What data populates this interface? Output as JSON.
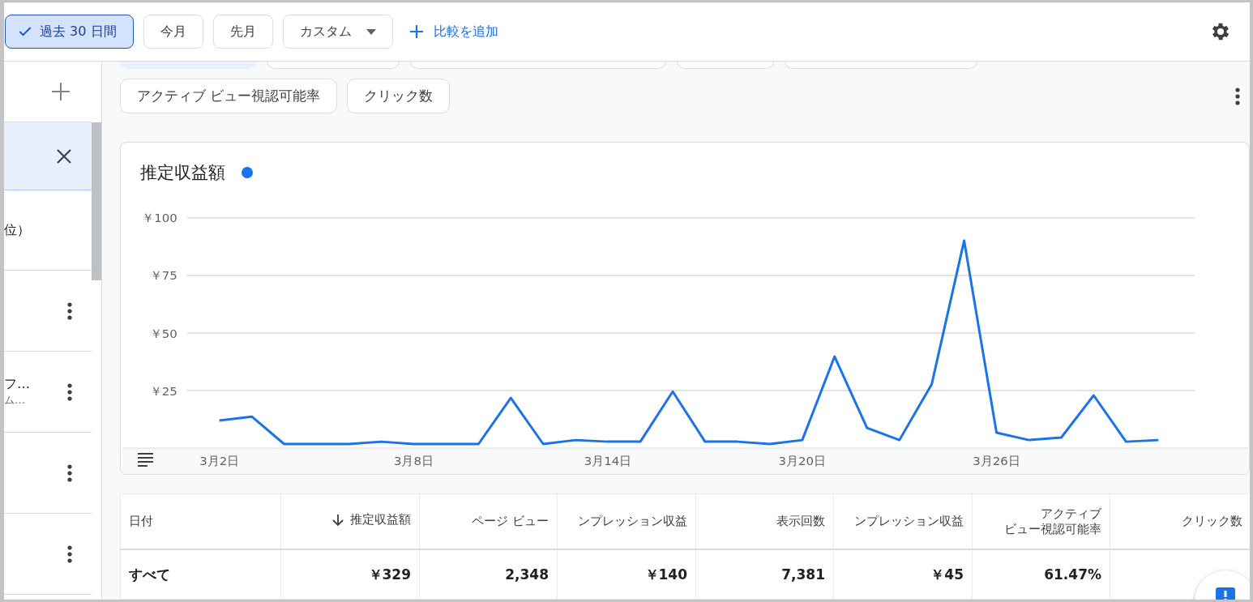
{
  "date_range": {
    "options": [
      {
        "label": "過去 30 日間",
        "selected": true,
        "kind": "preset"
      },
      {
        "label": "今月",
        "selected": false,
        "kind": "preset"
      },
      {
        "label": "先月",
        "selected": false,
        "kind": "preset"
      },
      {
        "label": "カスタム",
        "selected": false,
        "kind": "dropdown"
      }
    ],
    "add_comparison": "比較を追加"
  },
  "sidebar": {
    "items": [
      {
        "kind": "filter",
        "selected": true
      },
      {
        "kind": "text",
        "selected": false,
        "lines": [
          "位）"
        ]
      },
      {
        "kind": "menu",
        "selected": false
      },
      {
        "kind": "menu",
        "selected": false,
        "lines": [
          "フ…",
          "ム…"
        ]
      },
      {
        "kind": "menu",
        "selected": false
      },
      {
        "kind": "menu",
        "selected": false
      }
    ]
  },
  "metric_chips": {
    "cut_row": [
      {
        "selected": true
      },
      {
        "selected": false
      },
      {
        "selected": false
      },
      {
        "selected": false
      },
      {
        "selected": false
      }
    ],
    "chips": [
      {
        "label": "アクティブ ビュー視認可能率"
      },
      {
        "label": "クリック数"
      }
    ]
  },
  "chart": {
    "color": "#1a73e8",
    "chart_data": {
      "type": "line",
      "categories": [
        "3月2日",
        null,
        null,
        null,
        null,
        null,
        "3月8日",
        null,
        null,
        null,
        null,
        null,
        "3月14日",
        null,
        null,
        null,
        null,
        null,
        "3月20日",
        null,
        null,
        null,
        null,
        null,
        "3月26日",
        null,
        null,
        null,
        null,
        null
      ],
      "ylim": [
        0,
        100
      ],
      "grid": true,
      "yticks": [
        {
          "value": 25,
          "label": "￥25"
        },
        {
          "value": 50,
          "label": "￥50"
        },
        {
          "value": 75,
          "label": "￥75"
        },
        {
          "value": 100,
          "label": "￥100"
        }
      ],
      "series": [
        {
          "name": "推定収益額",
          "color": "#1a73e8",
          "values": [
            12,
            13.7,
            1.8,
            1.8,
            1.8,
            2.8,
            1.8,
            1.8,
            1.8,
            21.8,
            1.8,
            3.5,
            2.8,
            2.8,
            24.6,
            2.8,
            2.8,
            1.8,
            3.5,
            39.8,
            8.8,
            3.5,
            27.8,
            90.1,
            6.7,
            3.5,
            4.6,
            22.9,
            2.8,
            3.5
          ]
        }
      ]
    }
  },
  "table": {
    "columns": [
      {
        "label": "日付",
        "sorted": false
      },
      {
        "label": "推定収益額",
        "sorted": true
      },
      {
        "label": "ページ ビュー",
        "sorted": false
      },
      {
        "label": "ンプレッション収益",
        "sorted": false
      },
      {
        "label": "表示回数",
        "sorted": false
      },
      {
        "label": "ンプレッション収益",
        "sorted": false
      },
      {
        "lines": [
          "アクティブ",
          "ビュー視認可能率"
        ],
        "sorted": false
      },
      {
        "label": "クリック数",
        "sorted": false
      }
    ],
    "rows": [
      {
        "cells": [
          "すべて",
          "￥329",
          "2,348",
          "￥140",
          "7,381",
          "￥45",
          "61.47%",
          ""
        ]
      }
    ]
  }
}
